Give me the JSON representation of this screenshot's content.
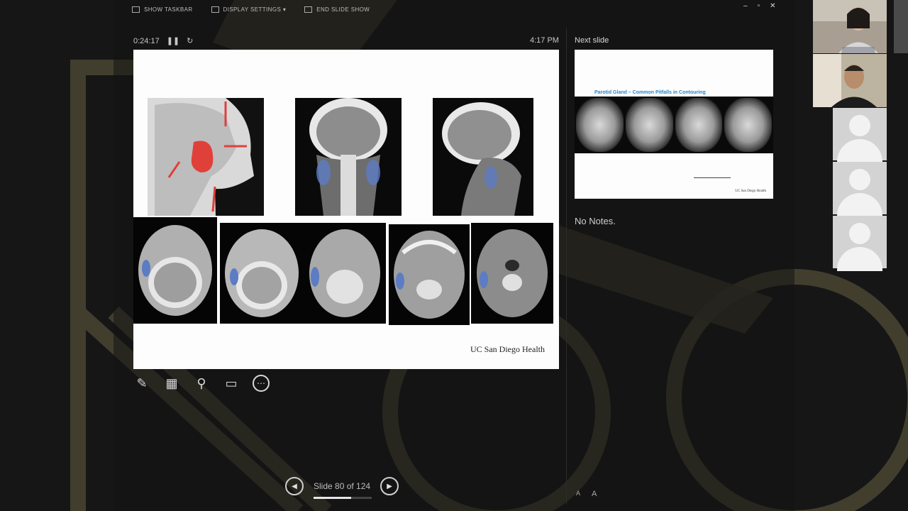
{
  "toolbar": {
    "show_taskbar": "SHOW TASKBAR",
    "display_settings": "DISPLAY SETTINGS ▾",
    "end_slide_show": "END SLIDE SHOW"
  },
  "window_controls": {
    "minimize": "–",
    "restore": "▫",
    "close": "✕"
  },
  "timer": {
    "elapsed": "0:24:17",
    "pause_icon": "pause-icon",
    "reset_icon": "reset-icon"
  },
  "clock": "4:17 PM",
  "current_slide": {
    "logo_text": "UC San Diego Health",
    "annotation_color": "#e0403a",
    "contour_color": "#5c7cc4"
  },
  "next_slide": {
    "label": "Next slide",
    "title": "Parotid Gland – Common Pitfalls in Contouring",
    "logo_text": "UC San Diego Health"
  },
  "notes": "No Notes.",
  "tools": [
    {
      "name": "pen-tool-icon",
      "glyph": "✎"
    },
    {
      "name": "see-all-slides-icon",
      "glyph": "▦"
    },
    {
      "name": "zoom-icon",
      "glyph": "⚲"
    },
    {
      "name": "black-screen-icon",
      "glyph": "▭"
    },
    {
      "name": "more-options-icon",
      "glyph": "⋯"
    }
  ],
  "navigation": {
    "prev_glyph": "◀",
    "next_glyph": "▶",
    "slide_counter": "Slide 80 of 124",
    "progress": 0.645
  },
  "font_controls": {
    "decrease": "A",
    "increase": "A"
  }
}
